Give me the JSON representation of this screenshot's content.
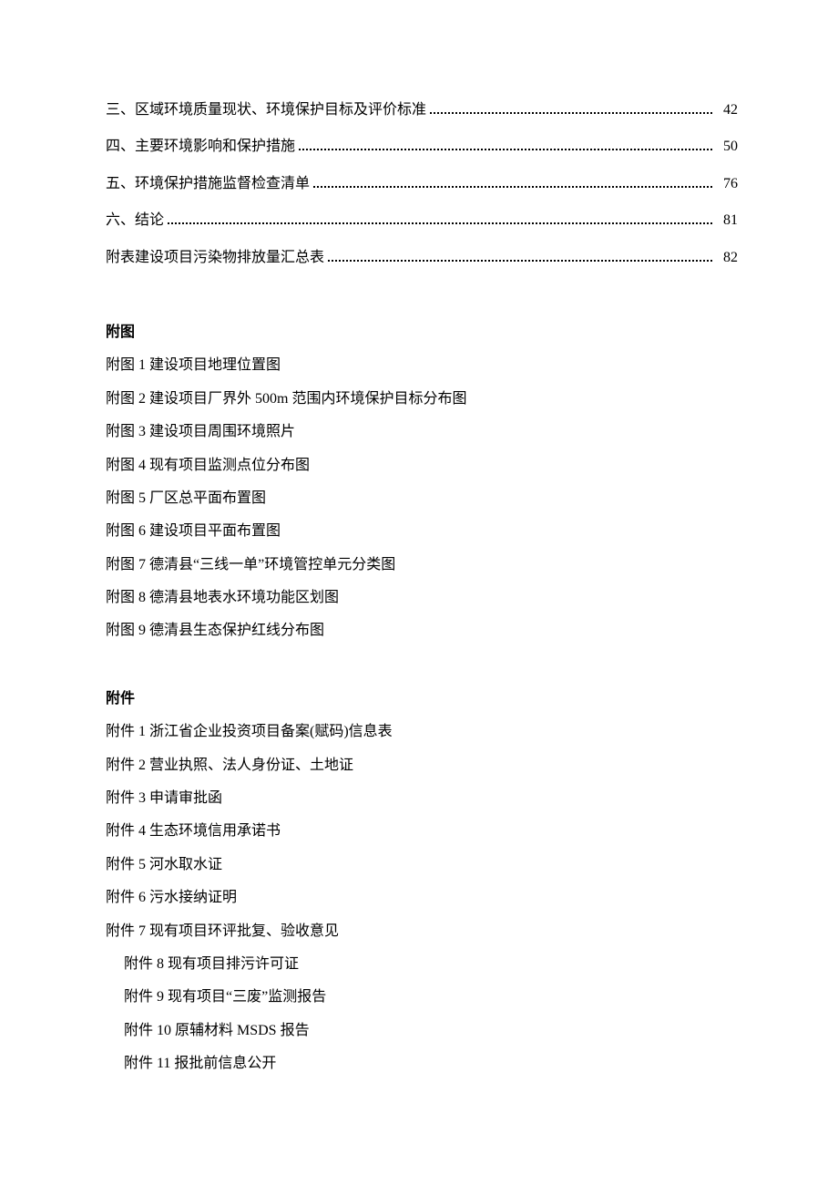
{
  "toc": [
    {
      "label": "三、区域环境质量现状、环境保护目标及评价标准",
      "page": "42"
    },
    {
      "label": "四、主要环境影响和保护措施",
      "page": "50"
    },
    {
      "label": "五、环境保护措施监督检查清单",
      "page": "76"
    },
    {
      "label": "六、结论",
      "page": "81"
    },
    {
      "label": "附表建设项目污染物排放量汇总表",
      "page": "82"
    }
  ],
  "figures_heading": "附图",
  "figures": [
    "附图 1 建设项目地理位置图",
    "附图 2 建设项目厂界外 500m 范围内环境保护目标分布图",
    "附图 3 建设项目周围环境照片",
    "附图 4 现有项目监测点位分布图",
    "附图 5 厂区总平面布置图",
    "附图 6 建设项目平面布置图",
    "附图 7 德清县“三线一单”环境管控单元分类图",
    "附图 8 德清县地表水环境功能区划图",
    "附图 9 德清县生态保护红线分布图"
  ],
  "attachments_heading": "附件",
  "attachments": [
    {
      "text": "附件 1 浙江省企业投资项目备案(赋码)信息表",
      "indent": false
    },
    {
      "text": "附件 2 营业执照、法人身份证、土地证",
      "indent": false
    },
    {
      "text": "附件 3 申请审批函",
      "indent": false
    },
    {
      "text": "附件 4 生态环境信用承诺书",
      "indent": false
    },
    {
      "text": "附件 5 河水取水证",
      "indent": false
    },
    {
      "text": "附件 6 污水接纳证明",
      "indent": false
    },
    {
      "text": "附件 7 现有项目环评批复、验收意见",
      "indent": false
    },
    {
      "text": "附件 8 现有项目排污许可证",
      "indent": true
    },
    {
      "text": "附件 9 现有项目“三废”监测报告",
      "indent": true
    },
    {
      "text": "附件 10 原辅材料 MSDS 报告",
      "indent": true
    },
    {
      "text": "附件 11 报批前信息公开",
      "indent": true
    }
  ]
}
